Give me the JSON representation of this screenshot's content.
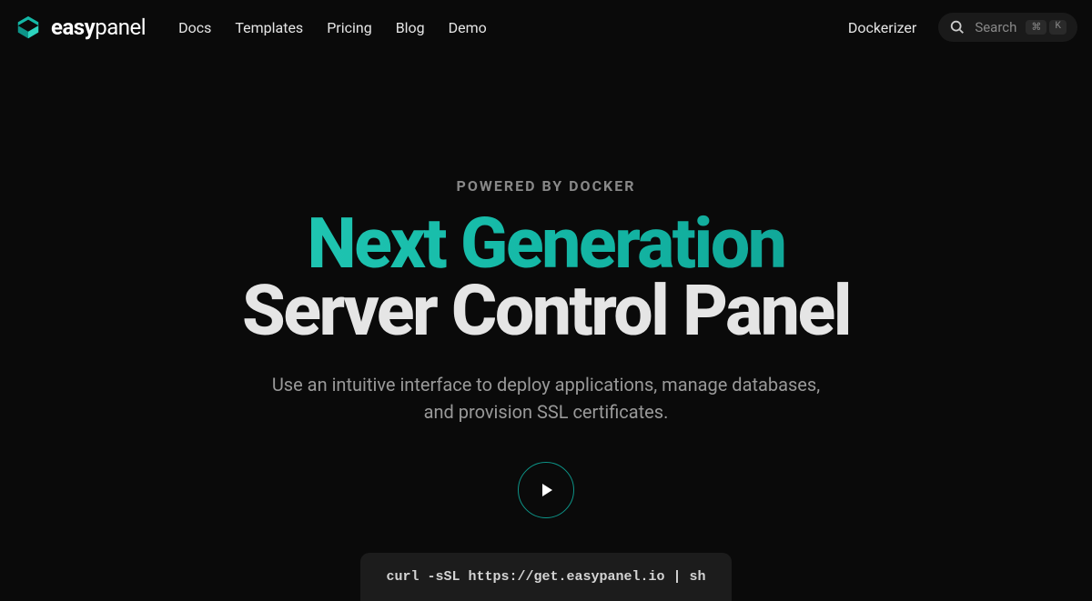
{
  "brand": {
    "name_prefix": "easy",
    "name_suffix": "panel"
  },
  "nav": {
    "items": [
      "Docs",
      "Templates",
      "Pricing",
      "Blog",
      "Demo"
    ]
  },
  "header_right": {
    "dockerizer": "Dockerizer",
    "search_placeholder": "Search",
    "kbd1": "⌘",
    "kbd2": "K"
  },
  "hero": {
    "eyebrow": "POWERED BY DOCKER",
    "headline1": "Next Generation",
    "headline2": "Server Control Panel",
    "subhead": "Use an intuitive interface to deploy applications, manage databases, and provision SSL certificates.",
    "install_command": "curl -sSL https://get.easypanel.io | sh"
  }
}
